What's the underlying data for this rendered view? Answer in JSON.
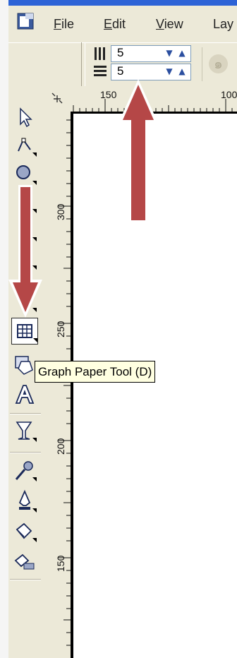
{
  "menu": {
    "items": [
      {
        "label": "File",
        "accel": "F",
        "rest": "ile"
      },
      {
        "label": "Edit",
        "accel": "E",
        "rest": "dit"
      },
      {
        "label": "View",
        "accel": "V",
        "rest": "iew"
      },
      {
        "label": "Lay",
        "accel": "",
        "rest": "Lay"
      }
    ]
  },
  "propbar": {
    "columns_value": "5",
    "rows_value": "5"
  },
  "ruler": {
    "h_labels": [
      "150",
      "100"
    ],
    "v_labels": [
      "300",
      "250",
      "200",
      "150"
    ]
  },
  "toolbox": {
    "tools": [
      "pick-tool-icon",
      "shape-tool-icon",
      "zoom-tool-icon",
      "freehand-tool-icon",
      "graph-paper-tool-icon",
      "basic-shapes-tool-icon",
      "text-tool-icon",
      "interactive-blend-tool-icon",
      "eyedropper-tool-icon",
      "outline-tool-icon",
      "fill-tool-icon",
      "interactive-fill-tool-icon"
    ]
  },
  "tooltip": {
    "text": "Graph Paper Tool (D)"
  },
  "colors": {
    "arrow": "#b54747",
    "arrow_outline": "#ffffff",
    "tooltip_bg": "#ffffe1",
    "chrome": "#ece9d8"
  }
}
